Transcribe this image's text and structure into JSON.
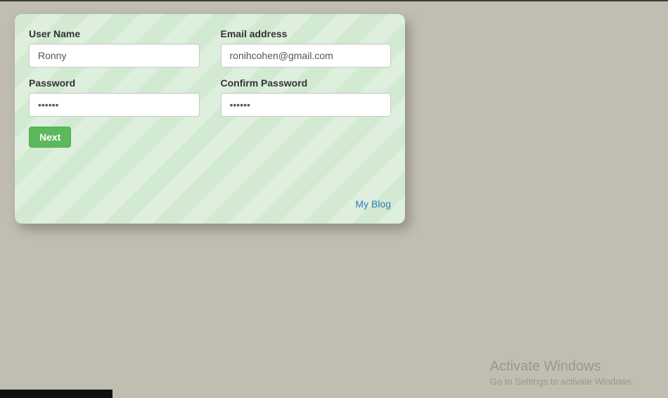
{
  "form": {
    "username": {
      "label": "User Name",
      "value": "Ronny"
    },
    "email": {
      "label": "Email address",
      "value": "ronihcohen@gmail.com"
    },
    "password": {
      "label": "Password",
      "value": "••••••"
    },
    "confirm": {
      "label": "Confirm Password",
      "value": "••••••"
    },
    "submit_label": "Next"
  },
  "footer": {
    "blog_link": "My Blog"
  },
  "watermark": {
    "title": "Activate Windows",
    "subtitle": "Go to Settings to activate Windows."
  }
}
